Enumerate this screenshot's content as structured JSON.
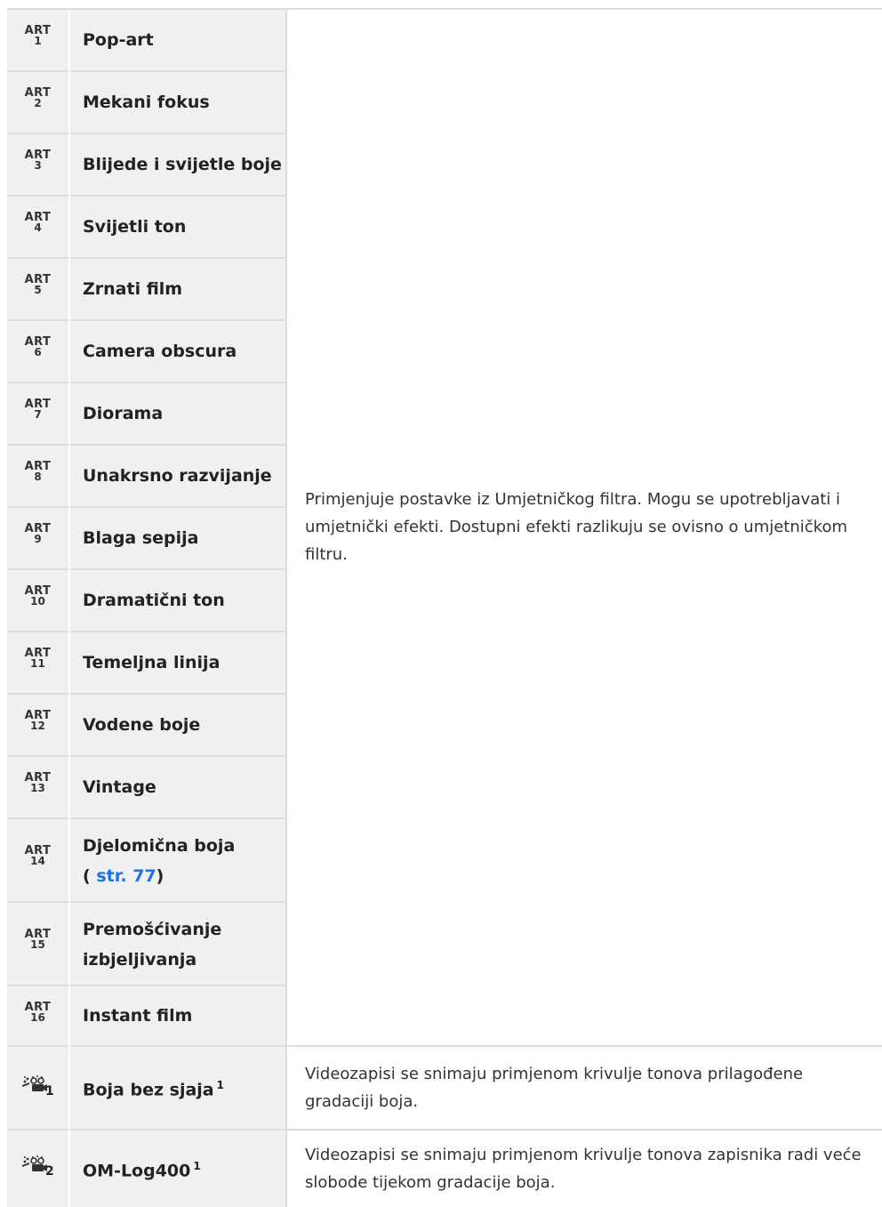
{
  "art_rows": [
    {
      "icon_label": "ART",
      "num": "1",
      "name": "Pop-art"
    },
    {
      "icon_label": "ART",
      "num": "2",
      "name": "Mekani fokus"
    },
    {
      "icon_label": "ART",
      "num": "3",
      "name": "Blijede i svijetle boje"
    },
    {
      "icon_label": "ART",
      "num": "4",
      "name": "Svijetli ton"
    },
    {
      "icon_label": "ART",
      "num": "5",
      "name": "Zrnati film"
    },
    {
      "icon_label": "ART",
      "num": "6",
      "name": "Camera obscura"
    },
    {
      "icon_label": "ART",
      "num": "7",
      "name": "Diorama"
    },
    {
      "icon_label": "ART",
      "num": "8",
      "name": "Unakrsno razvijanje"
    },
    {
      "icon_label": "ART",
      "num": "9",
      "name": "Blaga sepija"
    },
    {
      "icon_label": "ART",
      "num": "10",
      "name": "Dramatični ton"
    },
    {
      "icon_label": "ART",
      "num": "11",
      "name": "Temeljna linija"
    },
    {
      "icon_label": "ART",
      "num": "12",
      "name": "Vodene boje"
    },
    {
      "icon_label": "ART",
      "num": "13",
      "name": "Vintage"
    },
    {
      "icon_label": "ART",
      "num": "14",
      "name": "Djelomična boja",
      "link_prefix": "(",
      "link_text": "str. 77",
      "link_suffix": ")"
    },
    {
      "icon_label": "ART",
      "num": "15",
      "name": "Premošćivanje izbjeljivanja"
    },
    {
      "icon_label": "ART",
      "num": "16",
      "name": "Instant film"
    }
  ],
  "art_description": "Primjenjuje postavke iz Umjetničkog filtra. Mogu se upotrebljavati i umjetnički efekti. Dostupni efekti razlikuju se ovisno o umjetničkom filtru.",
  "video_rows": [
    {
      "icon": "video-profile-icon",
      "num": "1",
      "name": "Boja bez sjaja",
      "footnote": "1",
      "description": "Videozapisi se snimaju primjenom krivulje tonova prilagođene gradaciji boja."
    },
    {
      "icon": "video-profile-icon",
      "num": "2",
      "name": "OM-Log400",
      "footnote": "1",
      "description": "Videozapisi se snimaju primjenom krivulje tonova zapisnika radi veće slobode tijekom gradacije boja."
    }
  ]
}
